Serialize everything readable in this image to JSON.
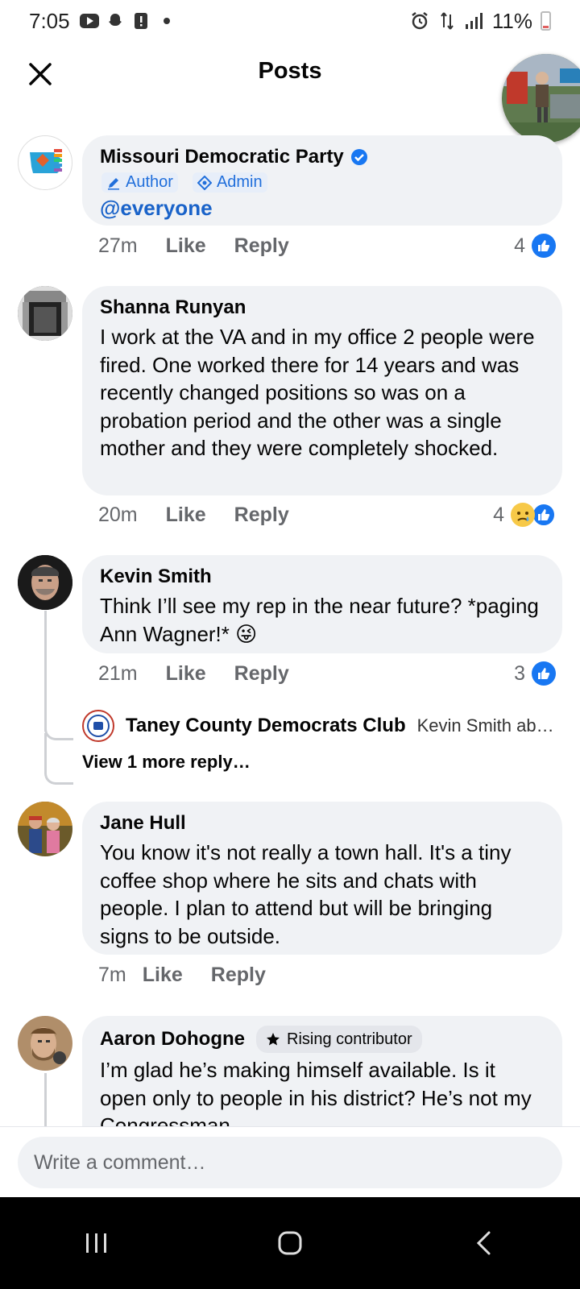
{
  "status_bar": {
    "time": "7:05",
    "battery_percent": "11%"
  },
  "header": {
    "title": "Posts",
    "close_icon": "close-icon"
  },
  "comments": [
    {
      "author": "Missouri Democratic Party",
      "verified": true,
      "roles": [
        "Author",
        "Admin"
      ],
      "text": "@everyone",
      "time": "27m",
      "like_label": "Like",
      "reply_label": "Reply",
      "reaction_count": "4",
      "reactions": [
        "like"
      ]
    },
    {
      "author": "Shanna Runyan",
      "text": "I work at the VA and in my office 2 people were fired. One worked there for 14 years and was recently changed positions so was on a probation period and the other was a single mother and they were completely shocked.",
      "time": "20m",
      "like_label": "Like",
      "reply_label": "Reply",
      "reaction_count": "4",
      "reactions": [
        "sad",
        "like"
      ]
    },
    {
      "author": "Kevin Smith",
      "text": "Think I’ll see my rep in the near future? *paging Ann Wagner!* 😜",
      "time": "21m",
      "like_label": "Like",
      "reply_label": "Reply",
      "reaction_count": "3",
      "reactions": [
        "like"
      ],
      "reply_preview": {
        "name": "Taney County Democrats Club",
        "snippet": "Kevin Smith abou…"
      },
      "view_more": "View 1 more reply…"
    },
    {
      "author": "Jane Hull",
      "text": "You know it's not really a town hall.  It's a tiny coffee shop where he sits and chats with people.  I plan to attend but will be bringing signs to be outside.",
      "time": "7m",
      "like_label": "Like",
      "reply_label": "Reply"
    },
    {
      "author": "Aaron Dohogne",
      "badge": "Rising contributor",
      "text": "I’m glad he’s making himself available. Is it open only to people in his district? He’s not my Congressman."
    }
  ],
  "composer": {
    "placeholder": "Write a comment…"
  },
  "colors": {
    "facebook_blue": "#1877f2",
    "bubble_gray": "#f0f2f5",
    "meta_gray": "#65676b"
  }
}
